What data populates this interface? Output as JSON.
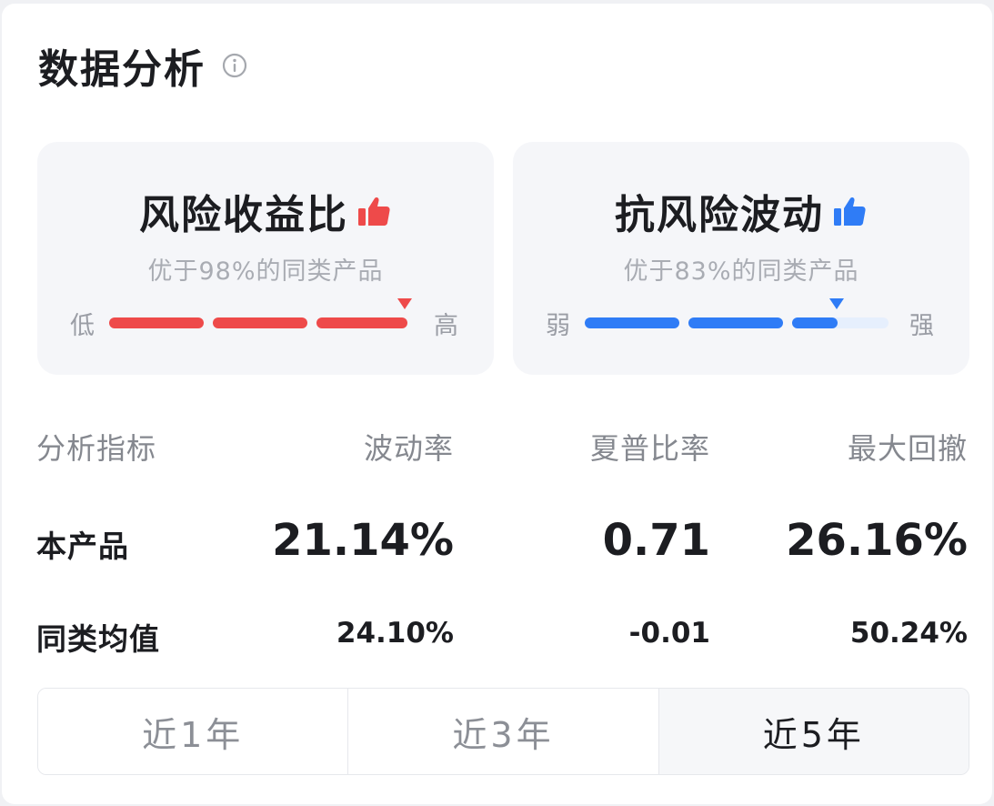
{
  "header": {
    "title": "数据分析",
    "info_icon": "info-circle-icon"
  },
  "risk_return": {
    "title": "风险收益比",
    "icon": "thumbs-up-icon",
    "subtitle": "优于98%的同类产品",
    "low_label": "低",
    "high_label": "高",
    "percentile": 98,
    "color": "#ee4a4a"
  },
  "anti_risk": {
    "title": "抗风险波动",
    "icon": "thumbs-up-icon",
    "subtitle": "优于83%的同类产品",
    "low_label": "弱",
    "high_label": "强",
    "percentile": 83,
    "color": "#2f7cf6",
    "track_color": "#e6effd"
  },
  "metrics": {
    "headers": [
      "分析指标",
      "波动率",
      "夏普比率",
      "最大回撤"
    ],
    "rows": [
      {
        "label": "本产品",
        "values": [
          "21.14%",
          "0.71",
          "26.16%"
        ]
      },
      {
        "label": "同类均值",
        "values": [
          "24.10%",
          "-0.01",
          "50.24%"
        ]
      }
    ]
  },
  "period_tabs": {
    "items": [
      "近1年",
      "近3年",
      "近5年"
    ],
    "selected": "近5年"
  }
}
